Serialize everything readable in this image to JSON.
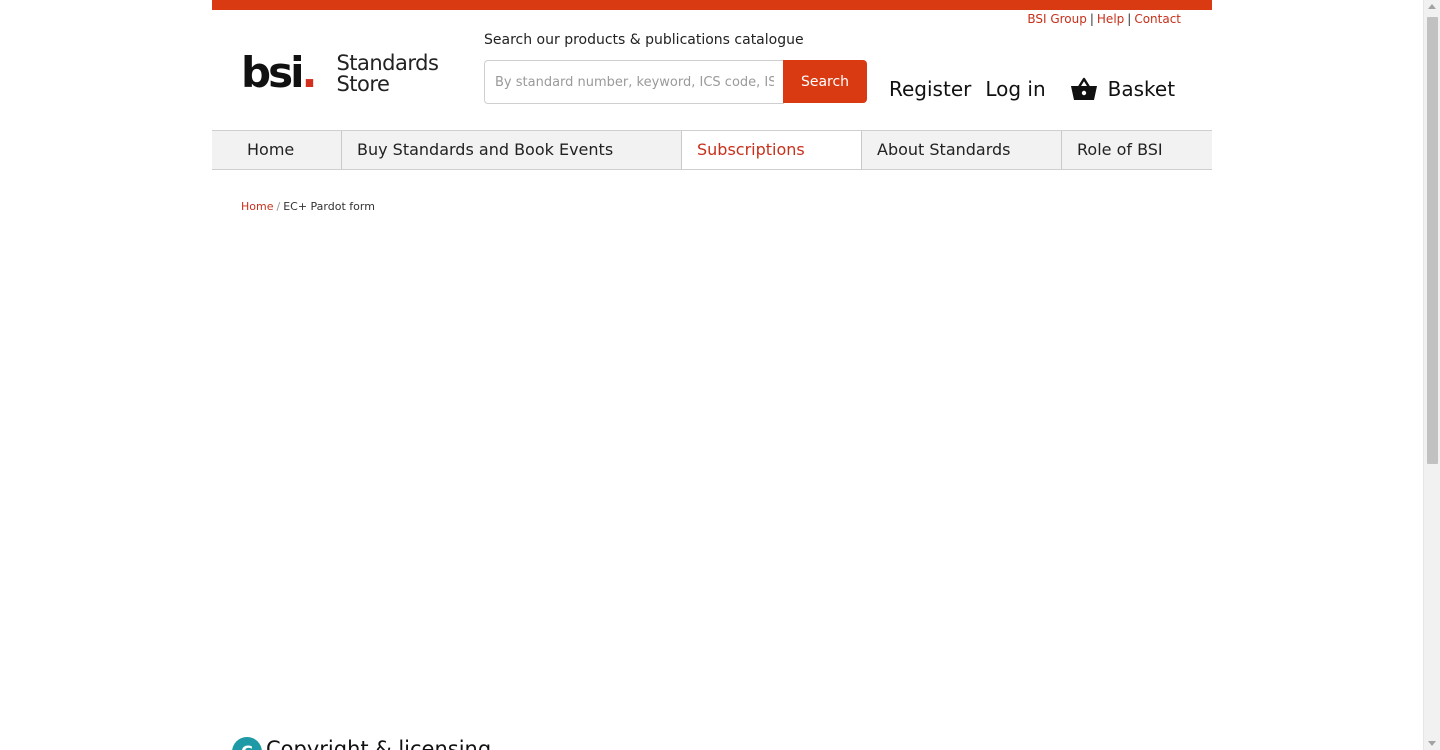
{
  "colors": {
    "brand_red": "#d93a12",
    "link_red": "#c7301b",
    "footer_accent": "#1d9aa6"
  },
  "utility_links": {
    "bsi_group": "BSI Group",
    "help": "Help",
    "contact": "Contact",
    "separator": "|"
  },
  "logo": {
    "wordmark": "bsi",
    "dot": ".",
    "store_line1": "Standards",
    "store_line2": "Store"
  },
  "search": {
    "label": "Search our products & publications catalogue",
    "placeholder": "By standard number, keyword, ICS code, ISBN",
    "value": "",
    "button_label": "Search"
  },
  "account": {
    "register": "Register",
    "login": "Log in",
    "basket": "Basket",
    "basket_icon": "basket-icon"
  },
  "nav": {
    "items": [
      {
        "label": "Home"
      },
      {
        "label": "Buy Standards and Book Events"
      },
      {
        "label": "Subscriptions"
      },
      {
        "label": "About Standards"
      },
      {
        "label": "Role of BSI"
      }
    ],
    "active": "Subscriptions"
  },
  "breadcrumb": {
    "home": "Home",
    "separator": "/",
    "current": "EC+ Pardot form"
  },
  "footer": {
    "circle_glyph": "C",
    "title": "Copyright & licensing"
  }
}
